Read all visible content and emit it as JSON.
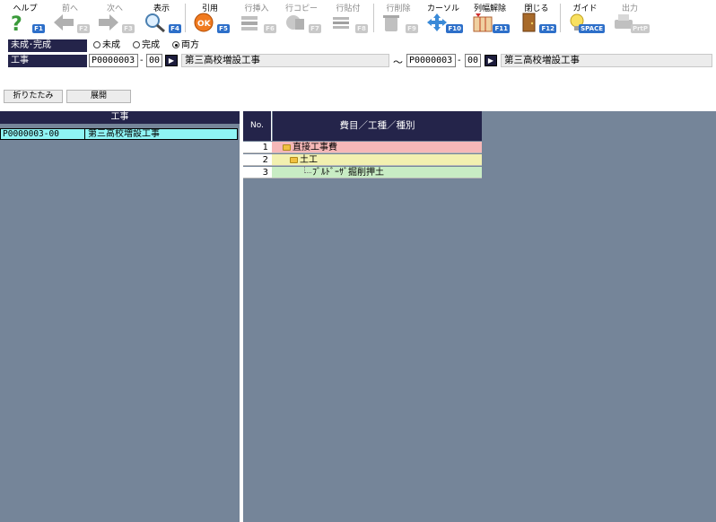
{
  "toolbar": {
    "buttons": [
      {
        "label": "ヘルプ",
        "key": "F1",
        "icon": "help-icon",
        "enabled": true
      },
      {
        "label": "前へ",
        "key": "F2",
        "icon": "arrow-left-icon",
        "enabled": false
      },
      {
        "label": "次へ",
        "key": "F3",
        "icon": "arrow-right-icon",
        "enabled": false
      },
      {
        "label": "表示",
        "key": "F4",
        "icon": "magnifier-icon",
        "enabled": true
      },
      {
        "label": "引用",
        "key": "F5",
        "icon": "ok-icon",
        "enabled": true
      },
      {
        "label": "行挿入",
        "key": "F6",
        "icon": "row-insert-icon",
        "enabled": false
      },
      {
        "label": "行コピー",
        "key": "F7",
        "icon": "row-copy-icon",
        "enabled": false
      },
      {
        "label": "行貼付",
        "key": "F8",
        "icon": "row-paste-icon",
        "enabled": false
      },
      {
        "label": "行削除",
        "key": "F9",
        "icon": "row-delete-icon",
        "enabled": false
      },
      {
        "label": "カーソル",
        "key": "F10",
        "icon": "cursor-icon",
        "enabled": true
      },
      {
        "label": "列幅解除",
        "key": "F11",
        "icon": "column-width-icon",
        "enabled": true
      },
      {
        "label": "閉じる",
        "key": "F12",
        "icon": "door-icon",
        "enabled": true
      },
      {
        "label": "ガイド",
        "key": "SPACE",
        "icon": "lightbulb-icon",
        "enabled": true
      },
      {
        "label": "出力",
        "key": "PrtP",
        "icon": "print-icon",
        "enabled": false
      }
    ]
  },
  "filters": {
    "status_label": "未成･完成",
    "status_options": [
      "未成",
      "完成",
      "両方"
    ],
    "status_selected": "両方",
    "project_label": "工事",
    "from_code": "P0000003",
    "from_sub": "00",
    "from_name": "第三高校増設工事",
    "range_sep": "～",
    "dash": "-",
    "to_code": "P0000003",
    "to_sub": "00",
    "to_name": "第三高校増設工事"
  },
  "actions": {
    "collapse_label": "折りたたみ",
    "expand_label": "展開"
  },
  "left_list": {
    "header": "工事",
    "rows": [
      {
        "code": "P0000003-00",
        "name": "第三高校増設工事"
      }
    ]
  },
  "grid": {
    "col_no": "No.",
    "col_name": "費目／工種／種別",
    "rows": [
      {
        "no": "1",
        "text": "直接工事費",
        "level": 0,
        "color": "#f5b8b8"
      },
      {
        "no": "2",
        "text": "土工",
        "level": 1,
        "color": "#f2f0b0"
      },
      {
        "no": "3",
        "text": "ﾌﾞﾙﾄﾞｰｻﾞ掘削押土",
        "level": 2,
        "color": "#c8ecc4"
      }
    ]
  },
  "colors": {
    "header_bg": "#24244a",
    "pane_bg": "#758599",
    "selected_row": "#8ff4f4",
    "fkey_badge": "#2d6fc9"
  }
}
